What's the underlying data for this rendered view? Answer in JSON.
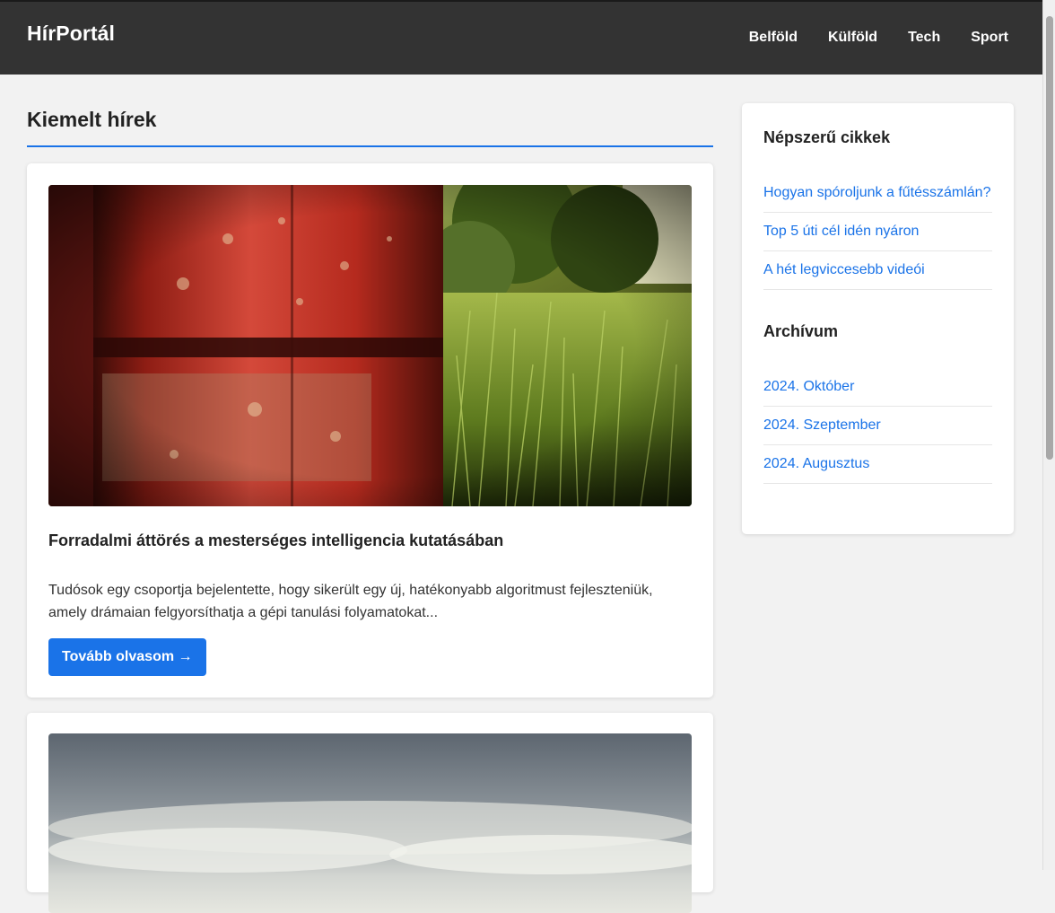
{
  "header": {
    "logo": "HírPortál",
    "nav": [
      "Belföld",
      "Külföld",
      "Tech",
      "Sport"
    ]
  },
  "main": {
    "title": "Kiemelt hírek",
    "articles": [
      {
        "title": "Forradalmi áttörés a mesterséges intelligencia kutatásában",
        "excerpt": "Tudósok egy csoportja bejelentette, hogy sikerült egy új, hatékonyabb algoritmust fejleszteniük, amely drámaian felgyorsíthatja a gépi tanulási folyamatokat...",
        "button": "Tovább olvasom →"
      }
    ]
  },
  "sidebar": {
    "popular_title": "Népszerű cikkek",
    "popular": [
      "Hogyan spóroljunk a fűtésszámlán?",
      "Top 5 úti cél idén nyáron",
      "A hét legviccesebb videói"
    ],
    "archive_title": "Archívum",
    "archive": [
      "2024. Október",
      "2024. Szeptember",
      "2024. Augusztus"
    ]
  },
  "colors": {
    "header_bg": "#333333",
    "accent": "#1a73e8",
    "page_bg": "#f2f2f2"
  }
}
